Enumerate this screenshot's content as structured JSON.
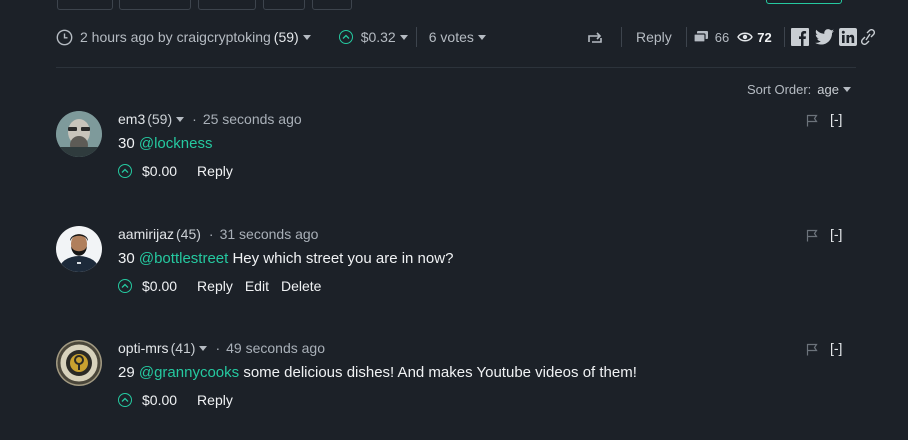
{
  "top_buttons": [
    "",
    "",
    "",
    "",
    ""
  ],
  "meta": {
    "time": "2 hours ago by",
    "author": "craigcryptoking",
    "rep": "(59)",
    "payout": "$0.32",
    "votes": "6 votes",
    "reply": "Reply",
    "comments": "66",
    "views": "72"
  },
  "sort": {
    "label": "Sort Order:",
    "value": "age"
  },
  "comments": [
    {
      "author": "em3",
      "rep": "(59)",
      "time": "25 seconds ago",
      "number": "30",
      "mention": "@lockness",
      "body": "",
      "payout": "$0.00",
      "actions": [
        "Reply"
      ],
      "collapse": "[-]"
    },
    {
      "author": "aamirijaz",
      "rep": "(45)",
      "time": "31 seconds ago",
      "number": "30",
      "mention": "@bottlestreet",
      "body": "Hey which street you are in now?",
      "payout": "$0.00",
      "actions": [
        "Reply",
        "Edit",
        "Delete"
      ],
      "collapse": "[-]"
    },
    {
      "author": "opti-mrs",
      "rep": "(41)",
      "time": "49 seconds ago",
      "number": "29",
      "mention": "@grannycooks",
      "body": "some delicious dishes! And makes Youtube videos of them!",
      "payout": "$0.00",
      "actions": [
        "Reply"
      ],
      "collapse": "[-]"
    }
  ],
  "colors": {
    "accent": "#25c9a0",
    "background": "#1c2128",
    "text": "#e4e7ea"
  }
}
